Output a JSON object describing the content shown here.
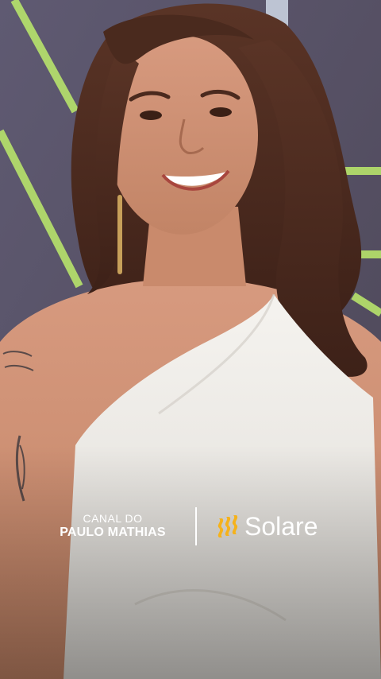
{
  "image": {
    "description_icon": "photo-woman-white-dress"
  },
  "branding": {
    "canal_line1": "CANAL DO",
    "canal_line2": "PAULO MATHIAS",
    "sponsor_name": "Solare",
    "sponsor_icon": "solare-logo-icon",
    "sponsor_icon_color": "#f5b21b"
  }
}
